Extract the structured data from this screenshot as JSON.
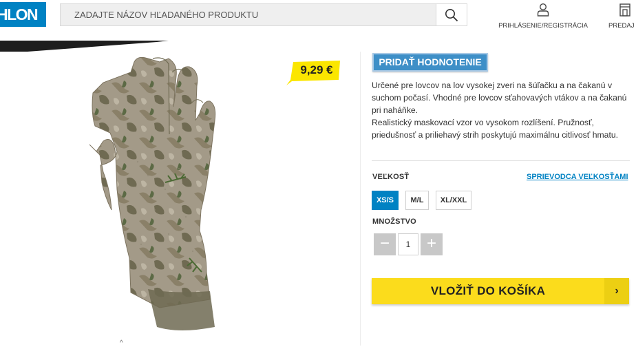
{
  "header": {
    "logo_text": "HLON",
    "search": {
      "placeholder": "ZADAJTE NÁZOV HĽADANÉHO PRODUKTU",
      "icon": "search-icon"
    },
    "login_label": "PRIHLÁSENIE/REGISTRÁCIA",
    "stores_label": "PREDAJ"
  },
  "product": {
    "price": "9,29 €",
    "rate_button": "PRIDAŤ HODNOTENIE",
    "description": [
      "Určené pre lovcov na lov vysokej zveri na šúľačku a na čakanú v suchom počasí. Vhodné pre lovcov sťahovavých vtákov a na čakanú pri naháňke.",
      "Realistický maskovací vzor vo vysokom rozlíšení. Pružnosť, priedušnosť a priliehavý strih poskytujú maximálnu citlivosť hmatu."
    ],
    "size_label": "VEĽKOSŤ",
    "size_guide": "SPRIEVODCA VEĽKOSŤAMI",
    "sizes": [
      "XS/S",
      "M/L",
      "XL/XXL"
    ],
    "selected_size": "XS/S",
    "quantity_label": "MNOŽSTVO",
    "quantity": "1",
    "minus": "−",
    "plus": "+",
    "cart_button": "VLOŽIŤ DO KOŠÍKA",
    "cart_arrow": "›"
  },
  "colors": {
    "brand_blue": "#0082c3",
    "cart_yellow": "#fbdc1c",
    "price_yellow": "#fbe600"
  }
}
